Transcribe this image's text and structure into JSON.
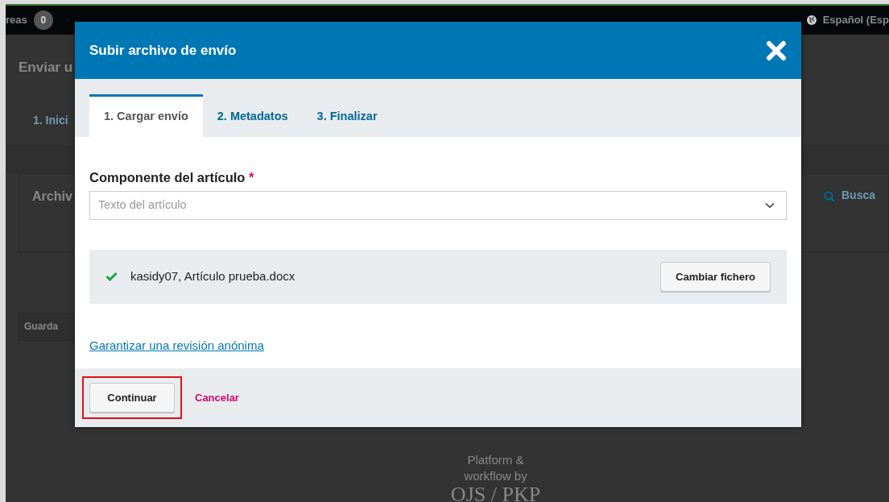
{
  "background": {
    "topbar": {
      "tasks_label": "reas",
      "tasks_count": "0",
      "language": "Español (Esp"
    },
    "page_title": "Enviar u",
    "steps": [
      "1. Inici"
    ],
    "panel_title": "Archiv",
    "search_label": "Busca",
    "save_button": "Guarda",
    "footer": {
      "line_1": "Platform &",
      "line_2": "workflow by",
      "logo": "OJS / PKP"
    }
  },
  "modal": {
    "title": "Subir archivo de envío",
    "tabs": [
      {
        "label": "1. Cargar envío",
        "selected": true
      },
      {
        "label": "2. Metadatos",
        "selected": false
      },
      {
        "label": "3. Finalizar",
        "selected": false
      }
    ],
    "field": {
      "label": "Componente del artículo",
      "required_mark": "*",
      "value": "Texto del artículo"
    },
    "file": {
      "uploaded": true,
      "name": "kasidy07, Artículo prueba.docx",
      "button": "Cambiar fichero"
    },
    "link": "Garantizar una revisión anónima",
    "buttons": {
      "continue": "Continuar",
      "cancel": "Cancelar"
    },
    "continue_highlighted": true
  }
}
